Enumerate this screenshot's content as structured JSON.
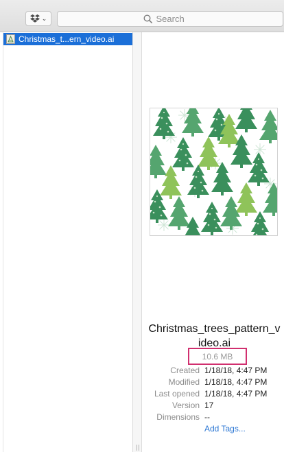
{
  "toolbar": {
    "dropbox_icon": "dropbox-icon",
    "dropdown_icon": "chevron-down-icon",
    "search": {
      "placeholder": "Search",
      "value": "",
      "icon": "search-icon"
    }
  },
  "sidebar": {
    "items": [
      {
        "label": "Christmas_t...ern_video.ai",
        "icon": "illustrator-file-icon",
        "selected": true
      }
    ]
  },
  "preview": {
    "filename": "Christmas_trees_pattern_video.ai",
    "size": "10.6 MB",
    "metadata": [
      {
        "key": "Created",
        "value": "1/18/18, 4:47 PM"
      },
      {
        "key": "Modified",
        "value": "1/18/18, 4:47 PM"
      },
      {
        "key": "Last opened",
        "value": "1/18/18, 4:47 PM"
      },
      {
        "key": "Version",
        "value": "17"
      },
      {
        "key": "Dimensions",
        "value": "--"
      }
    ],
    "add_tags_label": "Add Tags..."
  },
  "colors": {
    "selection": "#1b6fd8",
    "highlight_border": "#d12f6f",
    "link": "#2c77d4",
    "tree_dark": "#3a8f5c",
    "tree_mid": "#55a56f",
    "tree_light": "#8fc35a"
  }
}
